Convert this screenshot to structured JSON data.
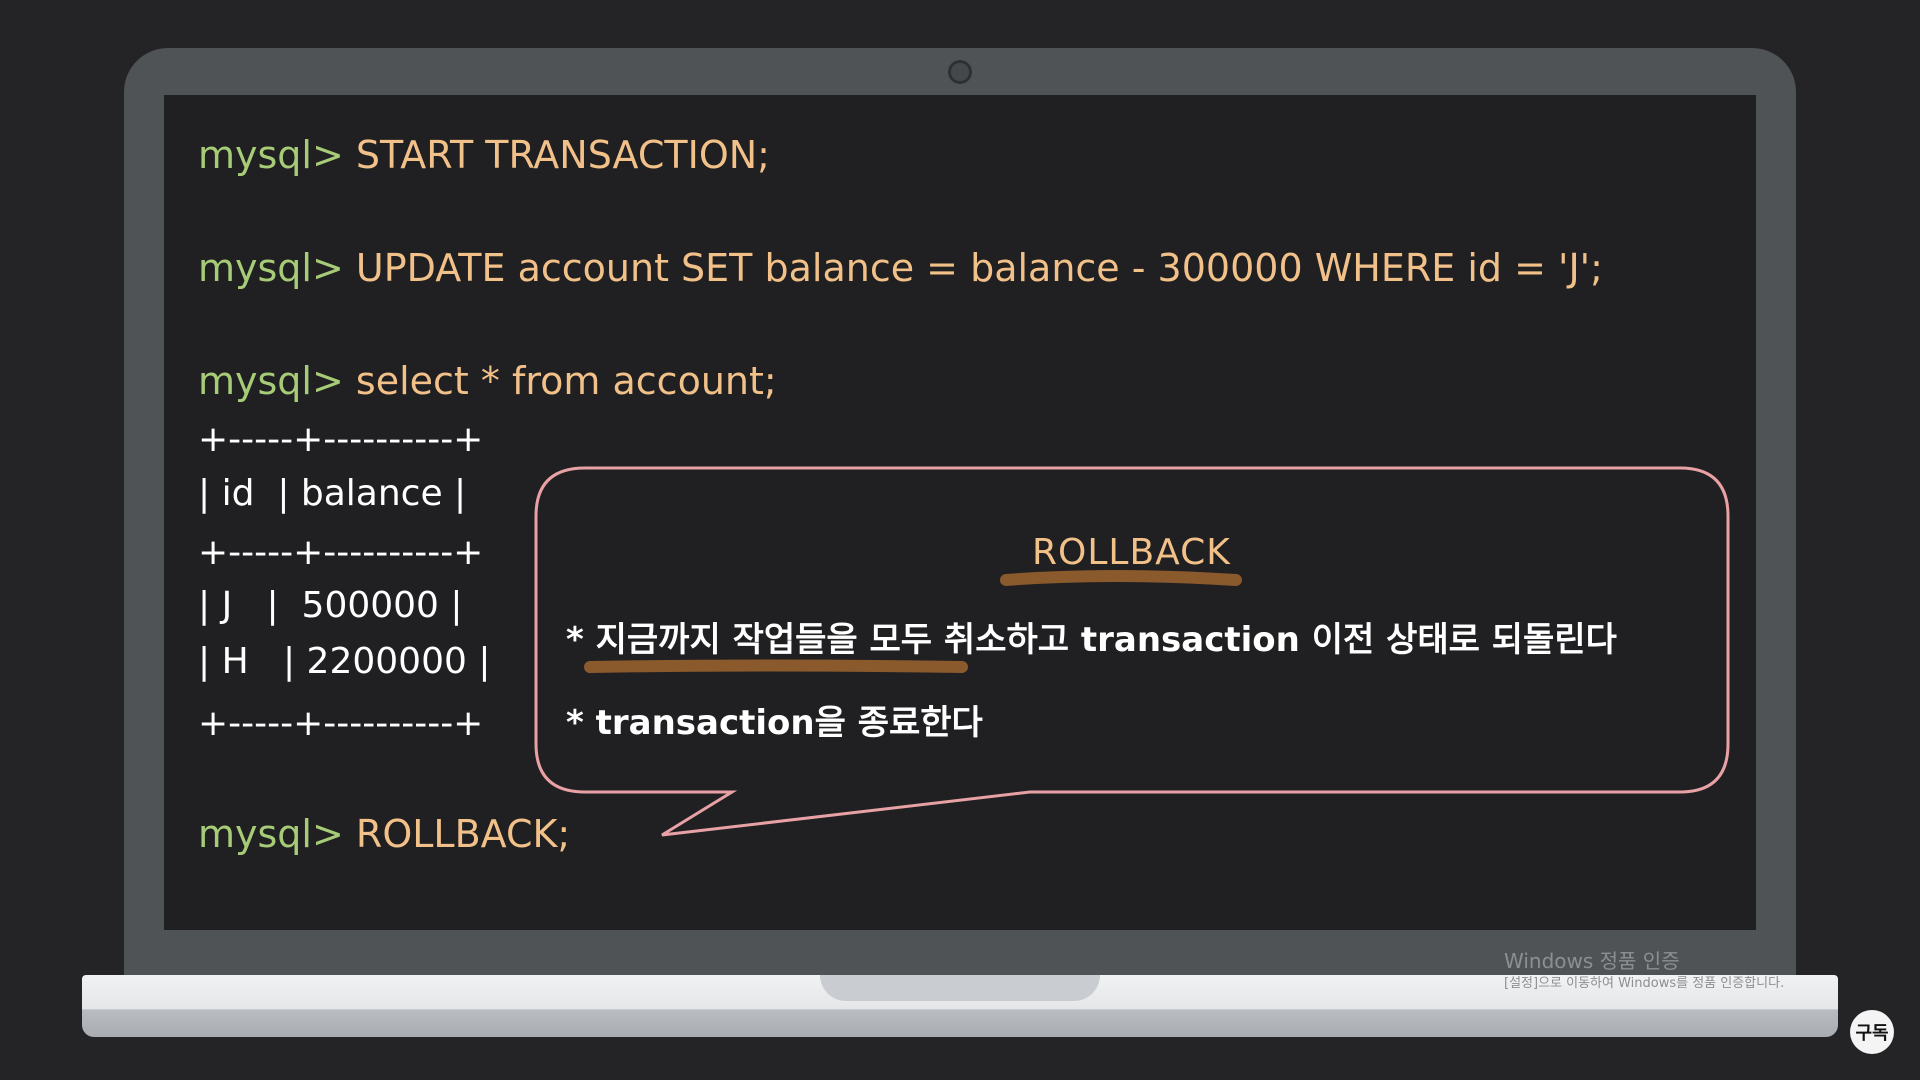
{
  "terminal": {
    "prompt": "mysql>",
    "commands": {
      "start": "START TRANSACTION;",
      "update": "UPDATE account SET balance = balance - 300000 WHERE id = 'J';",
      "select": "select * from account;",
      "rollback": "ROLLBACK;"
    },
    "table": {
      "border": "+-----+----------+",
      "header": "| id  | balance |",
      "rows": [
        "| J   |  500000 |",
        "| H   | 2200000 |"
      ]
    }
  },
  "callout": {
    "title": "ROLLBACK",
    "bullets": [
      "* 지금까지 작업들을 모두 취소하고 transaction 이전 상태로 되돌린다",
      "* transaction을 종료한다"
    ]
  },
  "watermark": {
    "line1": "Windows 정품 인증",
    "line2": "[설정]으로 이동하여 Windows를 정품 인증합니다."
  },
  "subscribe_label": "구독",
  "colors": {
    "prompt": "#a7cc77",
    "command": "#f2c189",
    "bubble_border": "#e8a1a5",
    "highlight_underline": "#8a5a2c"
  }
}
